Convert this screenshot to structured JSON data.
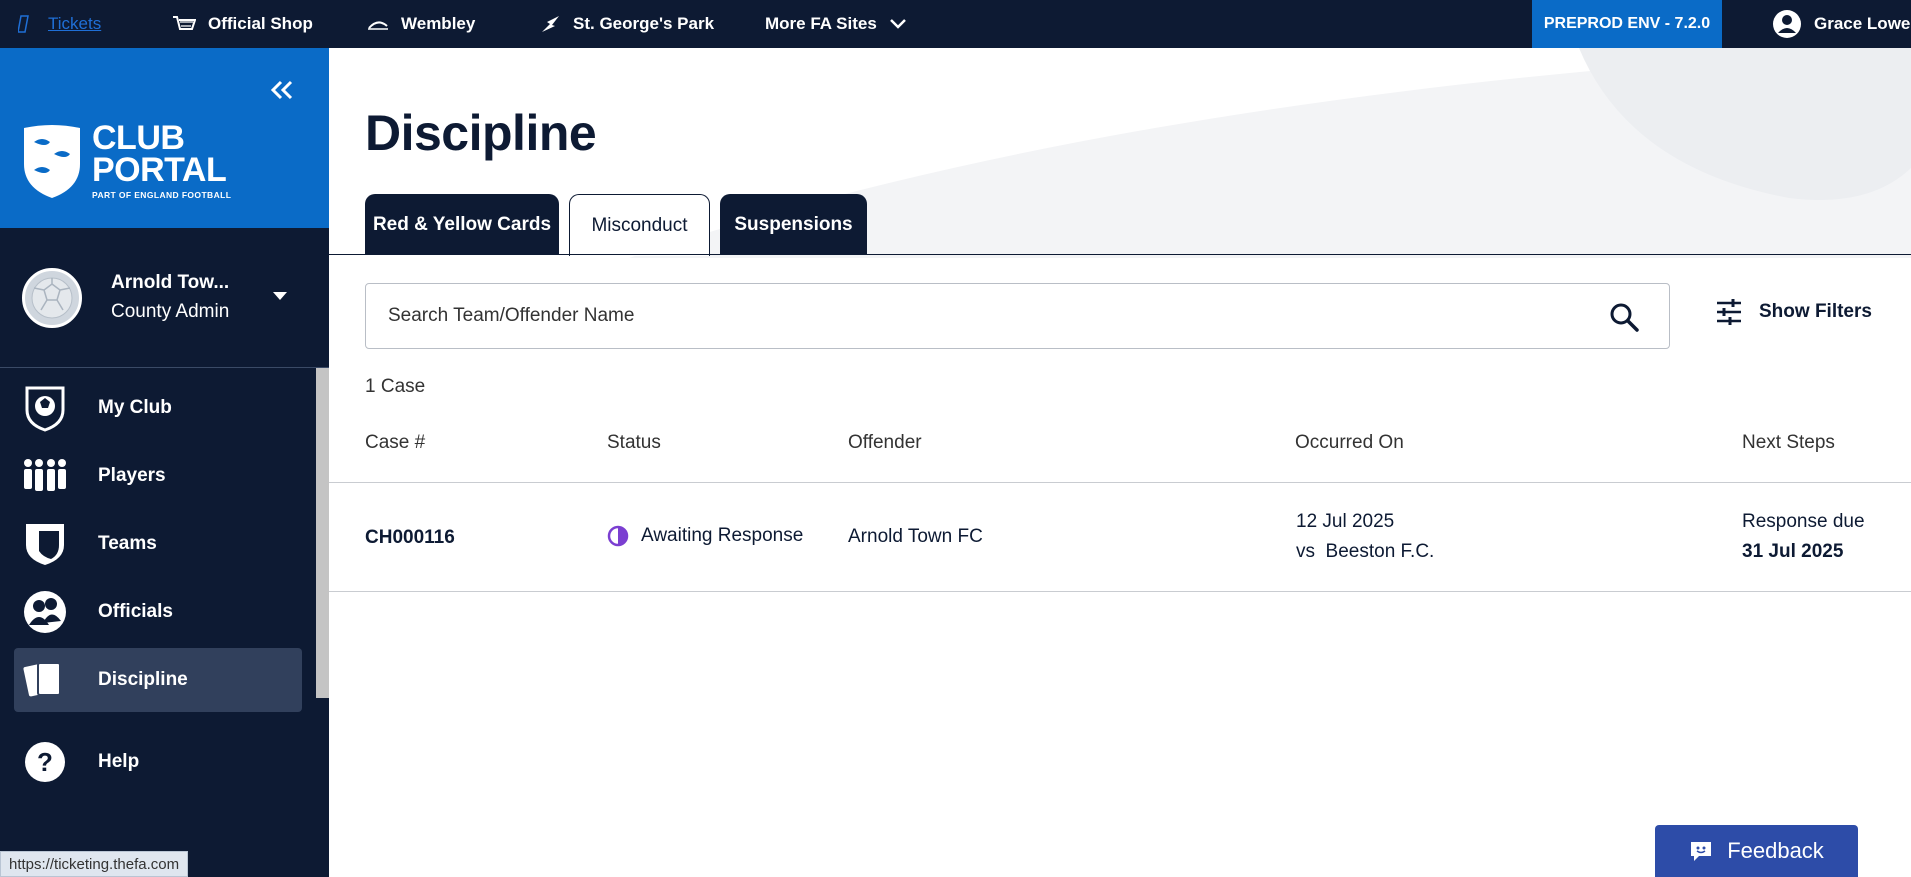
{
  "topbar": {
    "links": [
      {
        "label": "Tickets"
      },
      {
        "label": "Official Shop"
      },
      {
        "label": "Wembley"
      },
      {
        "label": "St. George's Park"
      },
      {
        "label": "More FA Sites"
      }
    ],
    "env_badge": "PREPROD ENV - 7.2.0",
    "user_name": "Grace Lowe"
  },
  "sidebar": {
    "brand": {
      "line1": "CLUB",
      "line2": "PORTAL",
      "tagline": "PART OF ENGLAND FOOTBALL"
    },
    "account": {
      "name": "Arnold Tow...",
      "role": "County Admin"
    },
    "items": [
      {
        "label": "My Club",
        "icon": "club-crest-icon"
      },
      {
        "label": "Players",
        "icon": "players-icon"
      },
      {
        "label": "Teams",
        "icon": "shield-icon"
      },
      {
        "label": "Officials",
        "icon": "officials-icon"
      },
      {
        "label": "Discipline",
        "icon": "cards-icon",
        "active": true
      },
      {
        "label": "Help",
        "icon": "help-icon"
      }
    ]
  },
  "status_bar_url": "https://ticketing.thefa.com",
  "main": {
    "title": "Discipline",
    "tabs": [
      {
        "label": "Red & Yellow Cards"
      },
      {
        "label": "Misconduct",
        "active": true
      },
      {
        "label": "Suspensions"
      }
    ],
    "search": {
      "placeholder": "Search Team/Offender Name"
    },
    "filters_label": "Show Filters",
    "case_count": "1 Case",
    "table": {
      "headers": [
        "Case #",
        "Status",
        "Offender",
        "Occurred On",
        "Next Steps"
      ],
      "rows": [
        {
          "case": "CH000116",
          "status": "Awaiting Response",
          "offender": "Arnold Town FC",
          "occurred_date": "12 Jul 2025",
          "occurred_vs": "vs  Beeston F.C.",
          "next_label": "Response due",
          "next_date": "31 Jul 2025"
        }
      ]
    },
    "feedback_label": "Feedback"
  },
  "colors": {
    "navy": "#0d1a33",
    "brand_blue": "#0a6bc7",
    "status_purple": "#7b3fd1",
    "feedback_blue": "#2d4ca8"
  }
}
